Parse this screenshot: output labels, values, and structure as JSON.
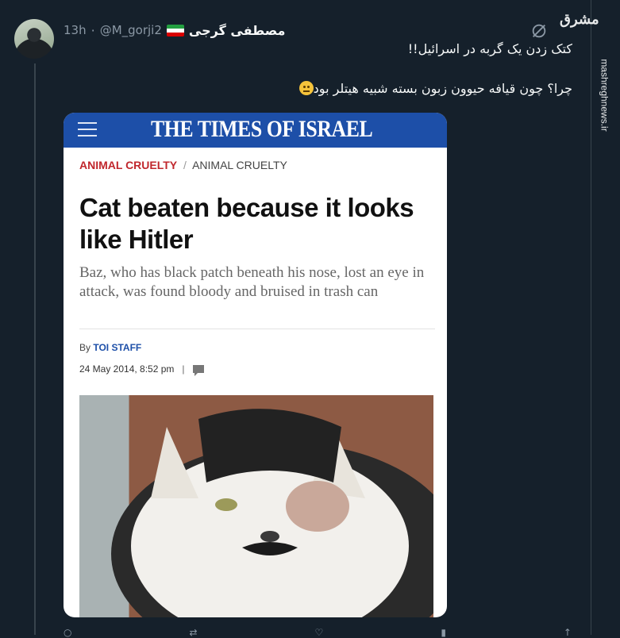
{
  "tweet": {
    "display_name": "مصطفی گرجی",
    "handle": "@M_gorji2",
    "separator": "·",
    "time": "13h",
    "line1": "کتک زدن یک گربه در اسرائیل!!",
    "line2": "چرا؟ چون قیافه حیوون زبون بسته شبیه هیتلر بود"
  },
  "watermark": {
    "logo": "مشرق",
    "url": "mashreghnews.ir"
  },
  "article": {
    "masthead": "THE TIMES OF ISRAEL",
    "category": "ANIMAL CRUELTY",
    "crumb_sep": "/",
    "subcategory": "ANIMAL CRUELTY",
    "headline": "Cat beaten because it looks like Hitler",
    "subtitle": "Baz, who has black patch beneath his nose, lost an eye in attack, was found bloody and bruised in trash can",
    "by_prefix": "By",
    "author": "TOI STAFF",
    "date": "24 May 2014, 8:52 pm",
    "date_sep": "|"
  },
  "colors": {
    "background": "#15202b",
    "banner": "#1d4fa8",
    "category_red": "#c0272d"
  }
}
